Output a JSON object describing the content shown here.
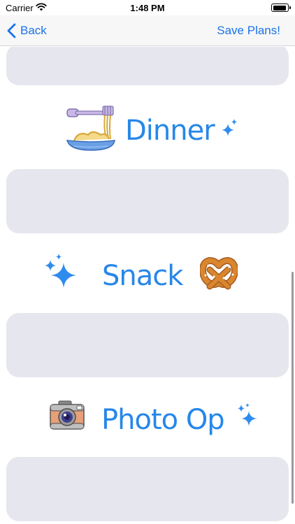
{
  "status_bar": {
    "carrier": "Carrier",
    "time": "1:48 PM"
  },
  "nav": {
    "back_label": "Back",
    "save_label": "Save Plans!"
  },
  "sections": [
    {
      "label": "Dinner",
      "icons": [
        "noodles-icon",
        "sparkle-icon"
      ]
    },
    {
      "label": "Snack",
      "icons": [
        "sparkle-icon",
        "pretzel-icon"
      ]
    },
    {
      "label": "Photo Op",
      "icons": [
        "camera-icon",
        "sparkle-icon"
      ]
    }
  ],
  "colors": {
    "accent": "#1a73e8",
    "label": "#2787e8",
    "card": "#e6e6ee",
    "nav_background": "#f7f7f8"
  }
}
